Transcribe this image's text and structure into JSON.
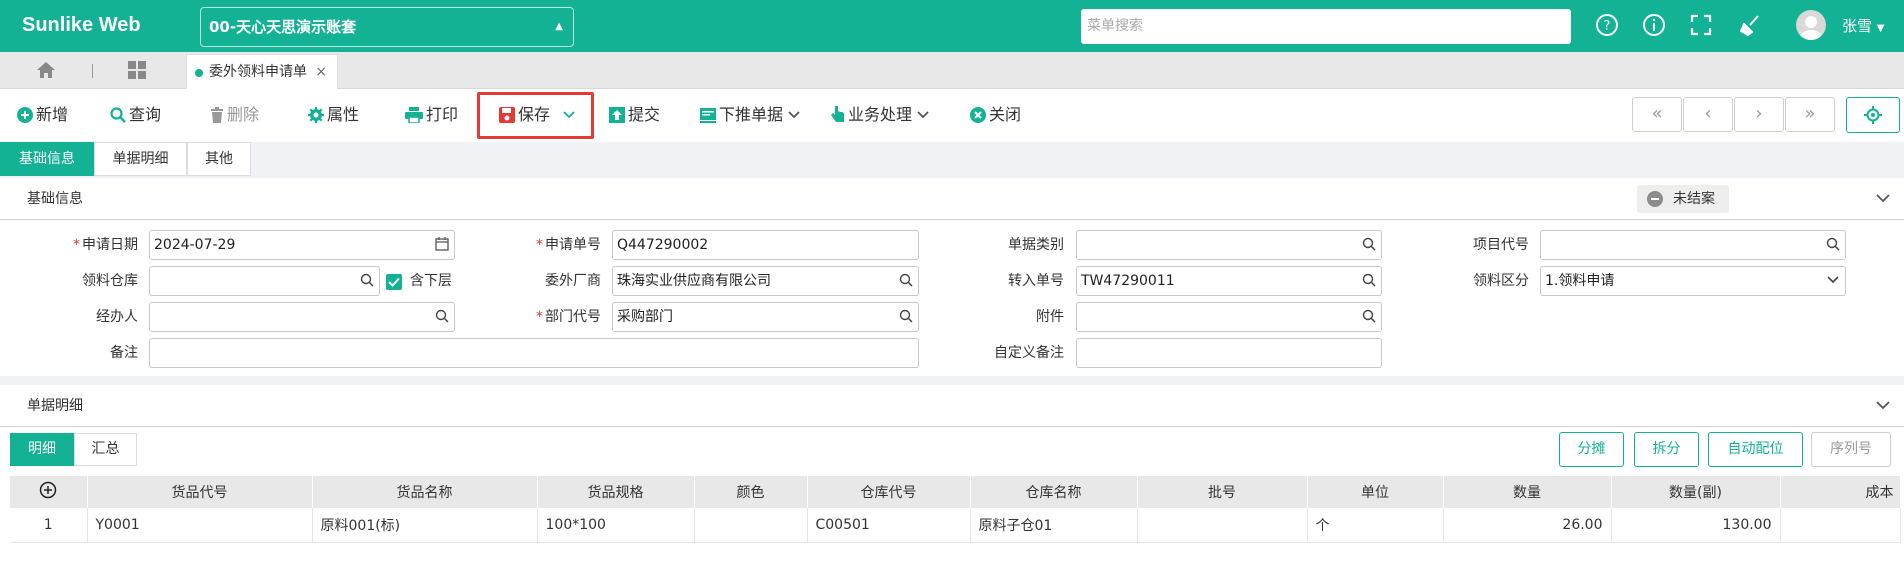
{
  "app": {
    "title": "Sunlike Web",
    "account": "00-天心天思演示账套",
    "search_placeholder": "菜单搜索",
    "user": "张雪"
  },
  "tabs": {
    "active": "委外领料申请单",
    "close": "×"
  },
  "toolbar": {
    "add": "新增",
    "query": "查询",
    "delete": "删除",
    "props": "属性",
    "print": "打印",
    "save": "保存",
    "submit": "提交",
    "push": "下推单据",
    "business": "业务处理",
    "close": "关闭"
  },
  "subtabs": [
    "基础信息",
    "单据明细",
    "其他"
  ],
  "basic": {
    "section_title": "基础信息",
    "status": "未结案",
    "fields": {
      "apply_date_label": "申请日期",
      "apply_date": "2024-07-29",
      "apply_no_label": "申请单号",
      "apply_no": "Q447290002",
      "doc_type_label": "单据类别",
      "doc_type": "",
      "project_label": "项目代号",
      "project": "",
      "warehouse_label": "领料仓库",
      "warehouse": "",
      "include_sub_label": "含下层",
      "vendor_label": "委外厂商",
      "vendor": "珠海实业供应商有限公司",
      "transfer_no_label": "转入单号",
      "transfer_no": "TW47290011",
      "pick_type_label": "领料区分",
      "pick_type": "1.领料申请",
      "handler_label": "经办人",
      "handler": "",
      "dept_label": "部门代号",
      "dept": "采购部门",
      "attachment_label": "附件",
      "attachment": "",
      "remark_label": "备注",
      "remark": "",
      "custom_remark_label": "自定义备注",
      "custom_remark": ""
    }
  },
  "detail": {
    "section_title": "单据明细",
    "tabs": [
      "明细",
      "汇总"
    ],
    "actions": [
      "分摊",
      "拆分",
      "自动配位",
      "序列号"
    ],
    "columns": [
      "",
      "货品代号",
      "货品名称",
      "货品规格",
      "颜色",
      "仓库代号",
      "仓库名称",
      "批号",
      "单位",
      "数量",
      "数量(副)",
      "成本"
    ],
    "rows": [
      {
        "idx": "1",
        "code": "Y0001",
        "name": "原料001(标)",
        "spec": "100*100",
        "color": "",
        "wh_code": "C00501",
        "wh_name": "原料子仓01",
        "batch": "",
        "unit": "个",
        "qty": "26.00",
        "qty2": "130.00",
        "cost": ""
      }
    ]
  },
  "colors": {
    "brand": "#13b294",
    "danger": "#e53935"
  }
}
